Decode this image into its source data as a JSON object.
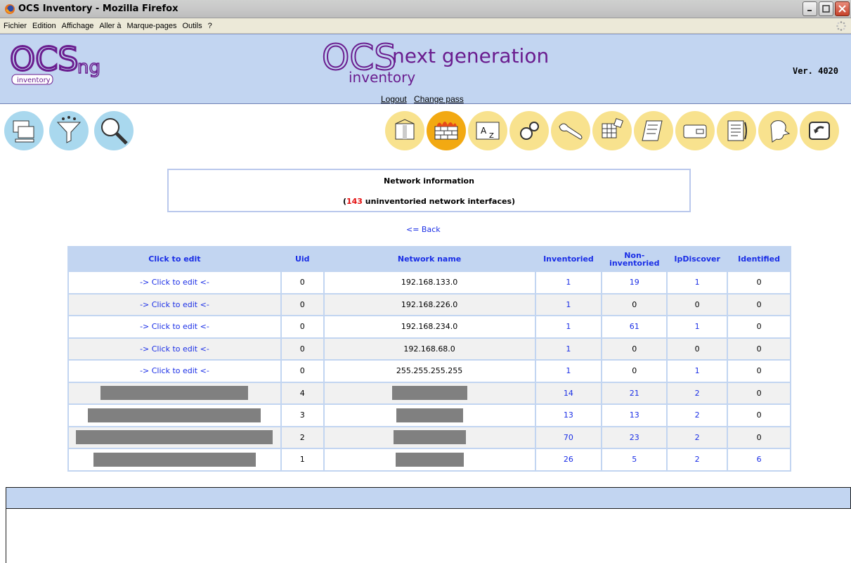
{
  "window": {
    "title": "OCS Inventory - Mozilla Firefox"
  },
  "menu": [
    {
      "label": "Fichier"
    },
    {
      "label": "Edition"
    },
    {
      "label": "Affichage"
    },
    {
      "label": "Aller à"
    },
    {
      "label": "Marque-pages"
    },
    {
      "label": "Outils"
    },
    {
      "label": "?"
    }
  ],
  "header": {
    "logo_left": "OCS ng inventory",
    "logo_center": "OCS next generation inventory",
    "version": "Ver. 4020",
    "logout": "Logout",
    "change_pass": "Change pass"
  },
  "icons_left": [
    "computers-icon",
    "filter-icon",
    "search-icon"
  ],
  "icons_right": [
    "packages-icon",
    "network-firewall-icon",
    "dictionary-icon",
    "config-icon",
    "tools-icon",
    "registry-icon",
    "files-icon",
    "deploy-icon",
    "logs-icon",
    "help-icon",
    "back-icon"
  ],
  "info": {
    "title": "Network information",
    "count": "143",
    "suffix": " uninventoried network interfaces)",
    "prefix": "("
  },
  "back_link": "<= Back",
  "table": {
    "headers": [
      "Click to edit",
      "Uid",
      "Network name",
      "Inventoried",
      "Non-inventoried",
      "IpDiscover",
      "Identified"
    ],
    "rows": [
      {
        "edit": "-> Click to edit <-",
        "uid": "0",
        "net": "192.168.133.0",
        "inv": "1",
        "noninv": "19",
        "ipd": "1",
        "ident": "0"
      },
      {
        "edit": "-> Click to edit <-",
        "uid": "0",
        "net": "192.168.226.0",
        "inv": "1",
        "noninv": "0",
        "ipd": "0",
        "ident": "0"
      },
      {
        "edit": "-> Click to edit <-",
        "uid": "0",
        "net": "192.168.234.0",
        "inv": "1",
        "noninv": "61",
        "ipd": "1",
        "ident": "0"
      },
      {
        "edit": "-> Click to edit <-",
        "uid": "0",
        "net": "192.168.68.0",
        "inv": "1",
        "noninv": "0",
        "ipd": "0",
        "ident": "0"
      },
      {
        "edit": "-> Click to edit <-",
        "uid": "0",
        "net": "255.255.255.255",
        "inv": "1",
        "noninv": "0",
        "ipd": "1",
        "ident": "0"
      },
      {
        "edit": "",
        "uid": "4",
        "net": "",
        "inv": "14",
        "noninv": "21",
        "ipd": "2",
        "ident": "0"
      },
      {
        "edit": "",
        "uid": "3",
        "net": "",
        "inv": "13",
        "noninv": "13",
        "ipd": "2",
        "ident": "0"
      },
      {
        "edit": "",
        "uid": "2",
        "net": "",
        "inv": "70",
        "noninv": "23",
        "ipd": "2",
        "ident": "0"
      },
      {
        "edit": "",
        "uid": "1",
        "net": "",
        "inv": "26",
        "noninv": "5",
        "ipd": "2",
        "ident": "6"
      }
    ]
  },
  "colors": {
    "header_bg": "#c2d5f1",
    "link": "#1a2ee6",
    "count_red": "#e41010",
    "redacted": "#808080"
  }
}
